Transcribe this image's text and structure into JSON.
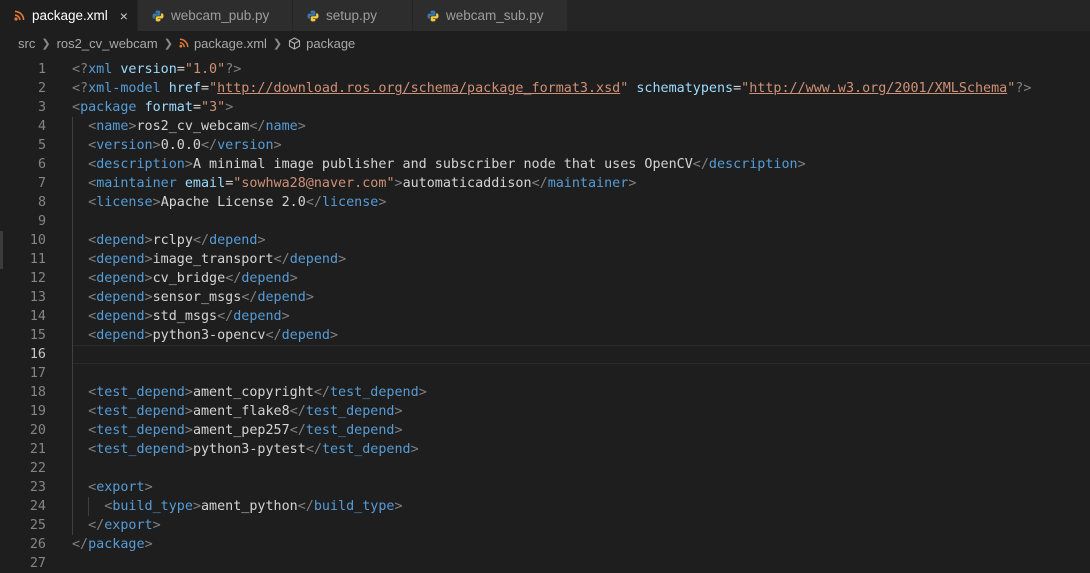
{
  "tabs": [
    {
      "label": "package.xml",
      "icon": "rss-icon",
      "active": true
    },
    {
      "label": "webcam_pub.py",
      "icon": "python-icon",
      "active": false
    },
    {
      "label": "setup.py",
      "icon": "python-icon",
      "active": false
    },
    {
      "label": "webcam_sub.py",
      "icon": "python-icon",
      "active": false
    }
  ],
  "close_glyph": "×",
  "breadcrumb": {
    "items": [
      "src",
      "ros2_cv_webcam",
      "package.xml",
      "package"
    ]
  },
  "editor": {
    "current_line": 16,
    "lines": [
      {
        "n": "1",
        "text": "<?xml version=\"1.0\"?>"
      },
      {
        "n": "2",
        "text": "<?xml-model href=\"http://download.ros.org/schema/package_format3.xsd\" schematypens=\"http://www.w3.org/2001/XMLSchema\"?>"
      },
      {
        "n": "3",
        "text": "<package format=\"3\">"
      },
      {
        "n": "4",
        "text": "  <name>ros2_cv_webcam</name>"
      },
      {
        "n": "5",
        "text": "  <version>0.0.0</version>"
      },
      {
        "n": "6",
        "text": "  <description>A minimal image publisher and subscriber node that uses OpenCV</description>"
      },
      {
        "n": "7",
        "text": "  <maintainer email=\"sowhwa28@naver.com\">automaticaddison</maintainer>"
      },
      {
        "n": "8",
        "text": "  <license>Apache License 2.0</license>"
      },
      {
        "n": "9",
        "text": ""
      },
      {
        "n": "10",
        "text": "  <depend>rclpy</depend>"
      },
      {
        "n": "11",
        "text": "  <depend>image_transport</depend>"
      },
      {
        "n": "12",
        "text": "  <depend>cv_bridge</depend>"
      },
      {
        "n": "13",
        "text": "  <depend>sensor_msgs</depend>"
      },
      {
        "n": "14",
        "text": "  <depend>std_msgs</depend>"
      },
      {
        "n": "15",
        "text": "  <depend>python3-opencv</depend>"
      },
      {
        "n": "16",
        "text": ""
      },
      {
        "n": "17",
        "text": ""
      },
      {
        "n": "18",
        "text": "  <test_depend>ament_copyright</test_depend>"
      },
      {
        "n": "19",
        "text": "  <test_depend>ament_flake8</test_depend>"
      },
      {
        "n": "20",
        "text": "  <test_depend>ament_pep257</test_depend>"
      },
      {
        "n": "21",
        "text": "  <test_depend>python3-pytest</test_depend>"
      },
      {
        "n": "22",
        "text": ""
      },
      {
        "n": "23",
        "text": "  <export>"
      },
      {
        "n": "24",
        "text": "    <build_type>ament_python</build_type>"
      },
      {
        "n": "25",
        "text": "  </export>"
      },
      {
        "n": "26",
        "text": "</package>"
      },
      {
        "n": "27",
        "text": ""
      }
    ]
  },
  "colors": {
    "background": "#1e1e1e",
    "tag": "#569cd6",
    "attribute": "#9cdcfe",
    "string": "#ce9178",
    "text": "#d4d4d4",
    "punctuation": "#808080"
  }
}
